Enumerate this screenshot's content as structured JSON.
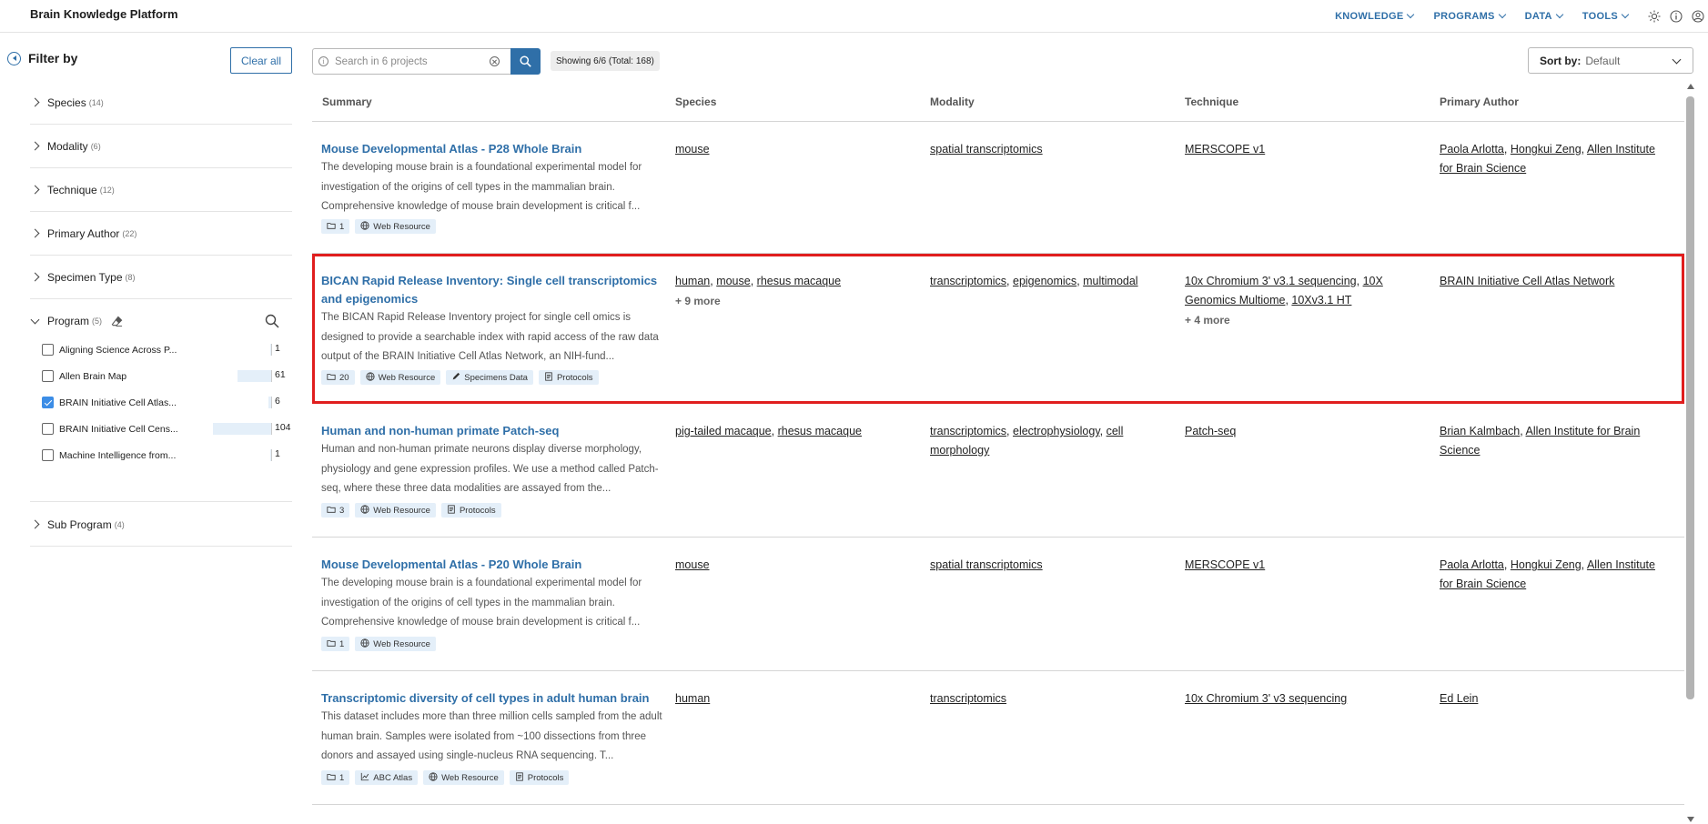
{
  "app": {
    "title": "Brain Knowledge Platform"
  },
  "nav": {
    "items": [
      {
        "label": "KNOWLEDGE"
      },
      {
        "label": "PROGRAMS"
      },
      {
        "label": "DATA"
      },
      {
        "label": "TOOLS"
      }
    ],
    "icons": [
      "theme-icon",
      "info-icon",
      "account-icon"
    ]
  },
  "sidebar": {
    "title": "Filter by",
    "clear_label": "Clear all",
    "facets": [
      {
        "label": "Species",
        "count": "(14)"
      },
      {
        "label": "Modality",
        "count": "(6)"
      },
      {
        "label": "Technique",
        "count": "(12)"
      },
      {
        "label": "Primary Author",
        "count": "(22)"
      },
      {
        "label": "Specimen Type",
        "count": "(8)"
      },
      {
        "label": "Program",
        "count": "(5)"
      },
      {
        "label": "Sub Program",
        "count": "(4)"
      }
    ],
    "programs": [
      {
        "label": "Aligning Science Across P...",
        "count": "1",
        "checked": false,
        "fraction": 0.01
      },
      {
        "label": "Allen Brain Map",
        "count": "61",
        "checked": false,
        "fraction": 0.59
      },
      {
        "label": "BRAIN Initiative Cell Atlas...",
        "count": "6",
        "checked": true,
        "fraction": 0.06
      },
      {
        "label": "BRAIN Initiative Cell Cens...",
        "count": "104",
        "checked": false,
        "fraction": 1.0
      },
      {
        "label": "Machine Intelligence from...",
        "count": "1",
        "checked": false,
        "fraction": 0.01
      }
    ]
  },
  "search": {
    "placeholder": "Search in 6 projects",
    "value": "",
    "count_label": "Showing 6/6 (Total: 168)"
  },
  "sort": {
    "label": "Sort by:",
    "value": "Default"
  },
  "table": {
    "columns": [
      "Summary",
      "Species",
      "Modality",
      "Technique",
      "Primary Author"
    ],
    "rows": [
      {
        "title": "Mouse Developmental Atlas - P28 Whole Brain",
        "description": "The developing mouse brain is a foundational experimental model for investigation of the origins of cell types in the mammalian brain. Comprehensive knowledge of mouse brain development is critical f...",
        "tags": [
          {
            "label": "1",
            "icon": "folder-icon"
          },
          {
            "label": "Web Resource",
            "icon": "globe-icon"
          }
        ],
        "species": [
          "mouse"
        ],
        "species_more": "",
        "modality": [
          "spatial transcriptomics"
        ],
        "technique": [
          "MERSCOPE v1"
        ],
        "technique_more": "",
        "authors": [
          "Paola Arlotta",
          "Hongkui Zeng",
          "Allen Institute for Brain Science"
        ]
      },
      {
        "title": "BICAN Rapid Release Inventory: Single cell transcriptomics and epigenomics",
        "description": "The BICAN Rapid Release Inventory project for single cell omics is designed to provide a searchable index with rapid access of the raw data output of the BRAIN Initiative Cell Atlas Network, an NIH-fund...",
        "tags": [
          {
            "label": "20",
            "icon": "folder-icon"
          },
          {
            "label": "Web Resource",
            "icon": "globe-icon"
          },
          {
            "label": "Specimens Data",
            "icon": "pipette-icon"
          },
          {
            "label": "Protocols",
            "icon": "document-icon"
          }
        ],
        "species": [
          "human",
          "mouse",
          "rhesus macaque"
        ],
        "species_more": "+ 9 more",
        "modality": [
          "transcriptomics",
          "epigenomics",
          "multimodal"
        ],
        "technique": [
          "10x Chromium 3' v3.1 sequencing",
          "10X Genomics Multiome",
          "10Xv3.1 HT"
        ],
        "technique_more": "+ 4 more",
        "authors": [
          "BRAIN Initiative Cell Atlas Network"
        ]
      },
      {
        "title": "Human and non-human primate Patch-seq",
        "description": "Human and non-human primate neurons display diverse morphology, physiology and gene expression profiles. We use a method called Patch-seq, where these three data modalities are assayed from the...",
        "tags": [
          {
            "label": "3",
            "icon": "folder-icon"
          },
          {
            "label": "Web Resource",
            "icon": "globe-icon"
          },
          {
            "label": "Protocols",
            "icon": "document-icon"
          }
        ],
        "species": [
          "pig-tailed macaque",
          "rhesus macaque"
        ],
        "species_more": "",
        "modality": [
          "transcriptomics",
          "electrophysiology",
          "cell morphology"
        ],
        "technique": [
          "Patch-seq"
        ],
        "technique_more": "",
        "authors": [
          "Brian Kalmbach",
          "Allen Institute for Brain Science"
        ]
      },
      {
        "title": "Mouse Developmental Atlas - P20 Whole Brain",
        "description": "The developing mouse brain is a foundational experimental model for investigation of the origins of cell types in the mammalian brain. Comprehensive knowledge of mouse brain development is critical f...",
        "tags": [
          {
            "label": "1",
            "icon": "folder-icon"
          },
          {
            "label": "Web Resource",
            "icon": "globe-icon"
          }
        ],
        "species": [
          "mouse"
        ],
        "species_more": "",
        "modality": [
          "spatial transcriptomics"
        ],
        "technique": [
          "MERSCOPE v1"
        ],
        "technique_more": "",
        "authors": [
          "Paola Arlotta",
          "Hongkui Zeng",
          "Allen Institute for Brain Science"
        ]
      },
      {
        "title": "Transcriptomic diversity of cell types in adult human brain",
        "description": "This dataset includes more than three million cells sampled from the adult human brain. Samples were isolated from ~100 dissections from three donors and assayed using single-nucleus RNA sequencing. T...",
        "tags": [
          {
            "label": "1",
            "icon": "folder-icon"
          },
          {
            "label": "ABC Atlas",
            "icon": "chart-icon"
          },
          {
            "label": "Web Resource",
            "icon": "globe-icon"
          },
          {
            "label": "Protocols",
            "icon": "document-icon"
          }
        ],
        "species": [
          "human"
        ],
        "species_more": "",
        "modality": [
          "transcriptomics"
        ],
        "technique": [
          "10x Chromium 3' v3 sequencing"
        ],
        "technique_more": "",
        "authors": [
          "Ed Lein"
        ]
      }
    ]
  },
  "colors": {
    "accent": "#2f6fa8",
    "tag_bg": "#e4eff9",
    "highlight": "#e01e1e",
    "checkbox": "#3c8de6"
  }
}
